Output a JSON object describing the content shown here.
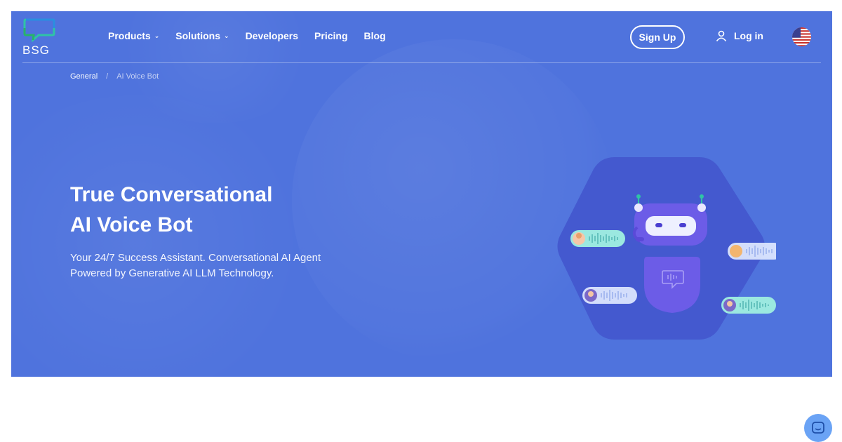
{
  "nav": {
    "logo_text": "BSG",
    "menu": [
      {
        "label": "Products",
        "has_dropdown": true
      },
      {
        "label": "Solutions",
        "has_dropdown": true
      },
      {
        "label": "Developers",
        "has_dropdown": false
      },
      {
        "label": "Pricing",
        "has_dropdown": false
      },
      {
        "label": "Blog",
        "has_dropdown": false
      }
    ],
    "signup_label": "Sign Up",
    "login_label": "Log in",
    "language_flag": "us-flag-icon"
  },
  "breadcrumb": {
    "items": [
      "General",
      "AI Voice Bot"
    ],
    "separator": "/"
  },
  "hero": {
    "title_line1": "True Conversational",
    "title_line2": "AI Voice Bot",
    "subtitle_line1": "Your 24/7 Success Assistant. Conversational AI Agent",
    "subtitle_line2": "Powered by Generative AI LLM Technology."
  },
  "colors": {
    "hero_background": "#4f73dd",
    "robot_body": "#6c5ce7",
    "hexagon": "#4459cf",
    "chat_widget": "#6aa3f5"
  }
}
